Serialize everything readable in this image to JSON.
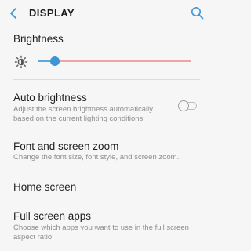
{
  "header": {
    "title": "DISPLAY",
    "back_icon": "back-arrow-icon",
    "search_icon": "search-icon",
    "accent_color": "#3d95d8"
  },
  "brightness": {
    "label": "Brightness",
    "icon": "brightness-sun-icon",
    "level": 0.11
  },
  "items": [
    {
      "title": "Auto brightness",
      "subtitle": "Adjust the screen brightness automatically based on the current lighting conditions.",
      "toggle_on": false
    },
    {
      "title": "Font and screen zoom",
      "subtitle": "Change the font size, font style, and screen zoom."
    },
    {
      "title": "Home screen"
    },
    {
      "title": "Full screen apps",
      "subtitle": "Choose which apps you want to use in the full screen aspect ratio."
    }
  ]
}
